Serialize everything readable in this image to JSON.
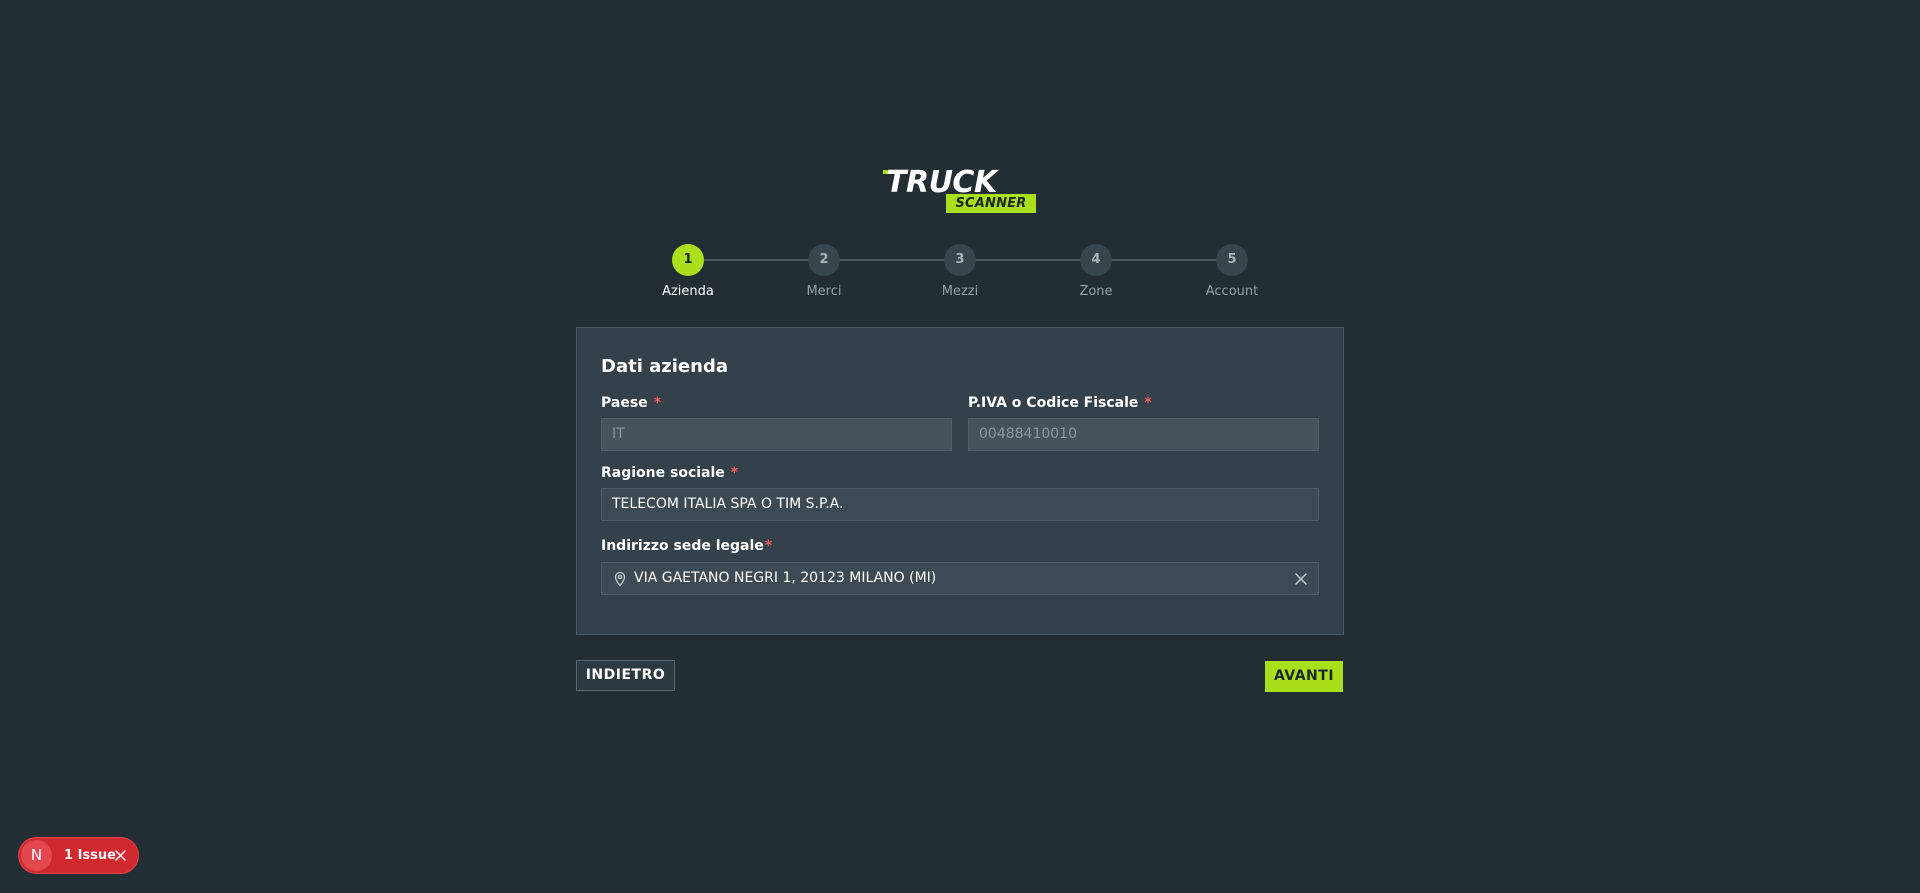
{
  "logo": {
    "line1": "TRUCK",
    "line2": "SCANNER"
  },
  "stepper": {
    "steps": [
      {
        "number": "1",
        "label": "Azienda",
        "active": true
      },
      {
        "number": "2",
        "label": "Merci",
        "active": false
      },
      {
        "number": "3",
        "label": "Mezzi",
        "active": false
      },
      {
        "number": "4",
        "label": "Zone",
        "active": false
      },
      {
        "number": "5",
        "label": "Account",
        "active": false
      }
    ]
  },
  "form": {
    "title": "Dati azienda",
    "required_mark": "*",
    "paese": {
      "label": "Paese",
      "value": "IT"
    },
    "piva": {
      "label": "P.IVA o Codice Fiscale",
      "value": "00488410010"
    },
    "ragione_sociale": {
      "label": "Ragione sociale",
      "value": "TELECOM ITALIA SPA O TIM S.P.A."
    },
    "indirizzo": {
      "label": "Indirizzo sede legale",
      "value": "VIA GAETANO NEGRI 1, 20123 MILANO (MI)"
    }
  },
  "actions": {
    "back_label": "INDIETRO",
    "next_label": "AVANTI"
  },
  "issue_badge": {
    "initial": "N",
    "text": "1 Issue"
  },
  "colors": {
    "background": "#222d34",
    "accent": "#a9e01a",
    "card": "#34414a",
    "required": "#ff5a5a",
    "issue": "#d0282f"
  },
  "icons": {
    "address": "map-pin-icon",
    "clear": "close-icon",
    "issue_close": "close-icon"
  }
}
